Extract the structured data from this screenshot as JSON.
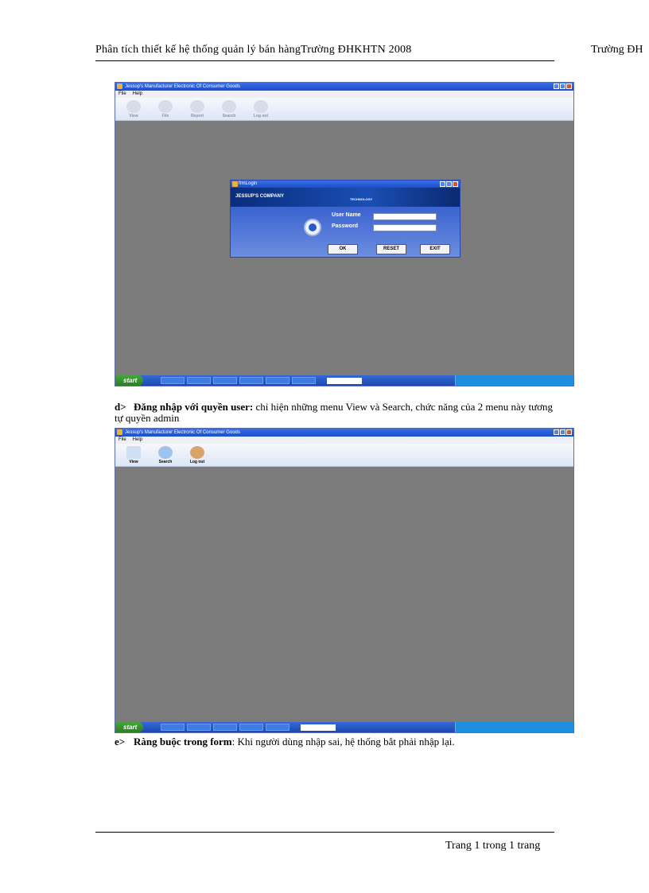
{
  "header": {
    "left": "Phân tích thiết kế hệ thống quản lý bán hàngTrường ĐHKHTN 2008",
    "right": "Trường ĐH"
  },
  "footer": {
    "page": "Trang  1 trong  1 trang"
  },
  "screenshot1": {
    "window_title": "Jessup's Manufacturer Electronic Of Consumer Goods",
    "menu": [
      "File",
      "Help"
    ],
    "toolbar": [
      "View",
      "File",
      "Report",
      "Search",
      "Log out"
    ],
    "login": {
      "title": "frmLogin",
      "company": "JESSUP'S COMPANY",
      "tagline": "TECHNOLOGY",
      "username_label": "User Name",
      "password_label": "Password",
      "ok": "OK",
      "reset": "RESET",
      "exit": "EXIT"
    },
    "taskbar": {
      "start": "start"
    }
  },
  "section_d": {
    "marker": "d>",
    "bold": "Đăng nhập  với quyền user:",
    "text": " chỉ hiện những menu View và Search, chức năng của 2 menu này tương tự quyền admin"
  },
  "screenshot2": {
    "window_title": "Jessup's Manufacturer Electronic Of Consumer Goods",
    "menu": [
      "File",
      "Help"
    ],
    "toolbar": [
      "View",
      "Search",
      "Log out"
    ],
    "taskbar": {
      "start": "start"
    }
  },
  "section_e": {
    "marker": "e>",
    "bold": "Ràng buộc trong form",
    "text": ": Khi người dùng nhập sai, hệ thống bắt phải nhập lại."
  },
  "colors": {
    "desktop": "#7b7b7b",
    "titlebar": "#1b4fc9",
    "taskbar": "#1e49b0",
    "start": "#2f7d25"
  }
}
